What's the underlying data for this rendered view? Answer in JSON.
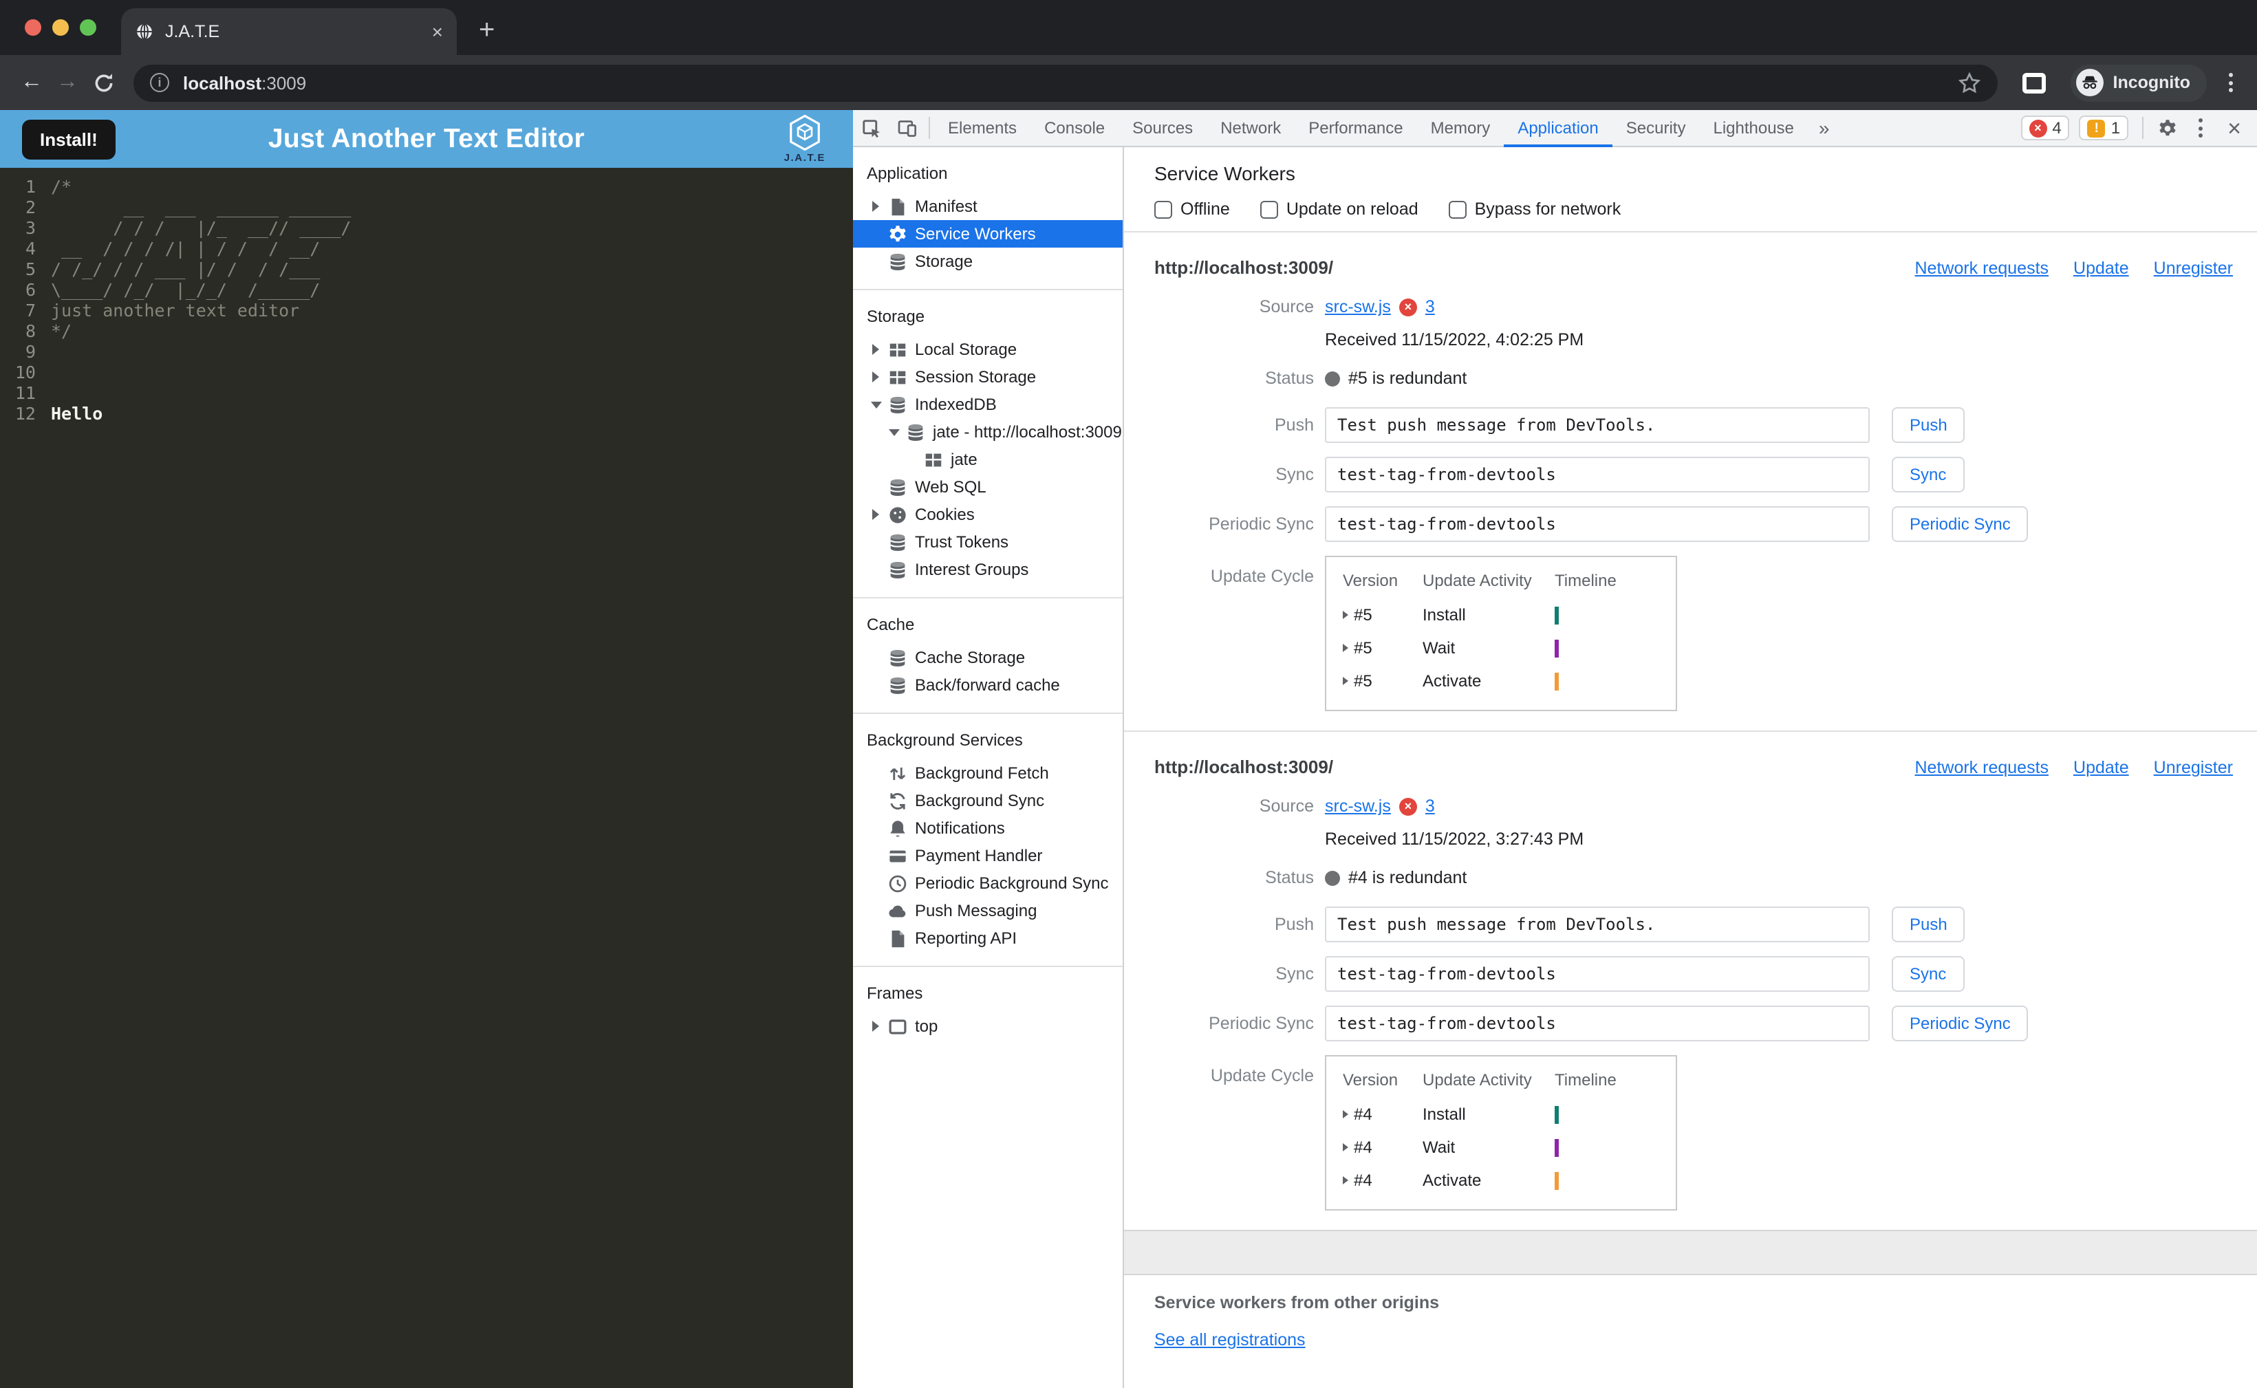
{
  "colors": {
    "accent_blue": "#1a73e8",
    "page_header_blue": "#57a7db",
    "install_install_timeline": "#0f7e71",
    "wait_timeline": "#8e24aa",
    "activate_timeline": "#f29b38"
  },
  "browser": {
    "tab_title": "J.A.T.E",
    "url_host": "localhost",
    "url_port": ":3009",
    "incognito_label": "Incognito"
  },
  "page": {
    "install_button": "Install!",
    "title": "Just Another Text Editor",
    "logo_text": "J.A.T.E",
    "editor": {
      "lines": [
        {
          "n": "1",
          "t": "/*"
        },
        {
          "n": "2",
          "t": "       __  ___  ______ ______"
        },
        {
          "n": "3",
          "t": "      / / /   |/_  __// ____/"
        },
        {
          "n": "4",
          "t": " __  / / / /| | / /  / __/"
        },
        {
          "n": "5",
          "t": "/ /_/ / / ___ |/ /  / /___"
        },
        {
          "n": "6",
          "t": "\\____/ /_/  |_/_/  /_____/"
        },
        {
          "n": "7",
          "t": "just another text editor"
        },
        {
          "n": "8",
          "t": "*/"
        },
        {
          "n": "9",
          "t": ""
        },
        {
          "n": "10",
          "t": ""
        },
        {
          "n": "11",
          "t": ""
        },
        {
          "n": "12",
          "t": "Hello"
        }
      ]
    }
  },
  "devtools": {
    "tabs": [
      {
        "label": "Elements"
      },
      {
        "label": "Console"
      },
      {
        "label": "Sources"
      },
      {
        "label": "Network"
      },
      {
        "label": "Performance"
      },
      {
        "label": "Memory"
      },
      {
        "label": "Application"
      },
      {
        "label": "Security"
      },
      {
        "label": "Lighthouse"
      }
    ],
    "more_tabs_glyph": "»",
    "badges": {
      "errors": "4",
      "warnings": "1"
    },
    "sidebar": {
      "sections": [
        {
          "title": "Application",
          "items": [
            {
              "label": "Manifest",
              "icon": "file-icon"
            },
            {
              "label": "Service Workers",
              "icon": "gear-icon"
            },
            {
              "label": "Storage",
              "icon": "database-icon"
            }
          ]
        },
        {
          "title": "Storage",
          "items": [
            {
              "label": "Local Storage",
              "icon": "table-icon"
            },
            {
              "label": "Session Storage",
              "icon": "table-icon"
            },
            {
              "label": "IndexedDB",
              "icon": "database-icon"
            },
            {
              "label": "jate - http://localhost:3009",
              "icon": "database-icon"
            },
            {
              "label": "jate",
              "icon": "table-icon"
            },
            {
              "label": "Web SQL",
              "icon": "database-icon"
            },
            {
              "label": "Cookies",
              "icon": "cookie-icon"
            },
            {
              "label": "Trust Tokens",
              "icon": "database-icon"
            },
            {
              "label": "Interest Groups",
              "icon": "database-icon"
            }
          ]
        },
        {
          "title": "Cache",
          "items": [
            {
              "label": "Cache Storage",
              "icon": "database-icon"
            },
            {
              "label": "Back/forward cache",
              "icon": "database-icon"
            }
          ]
        },
        {
          "title": "Background Services",
          "items": [
            {
              "label": "Background Fetch",
              "icon": "fetch-icon"
            },
            {
              "label": "Background Sync",
              "icon": "sync-icon"
            },
            {
              "label": "Notifications",
              "icon": "bell-icon"
            },
            {
              "label": "Payment Handler",
              "icon": "payment-icon"
            },
            {
              "label": "Periodic Background Sync",
              "icon": "clock-icon"
            },
            {
              "label": "Push Messaging",
              "icon": "cloud-icon"
            },
            {
              "label": "Reporting API",
              "icon": "file-icon"
            }
          ]
        },
        {
          "title": "Frames",
          "items": [
            {
              "label": "top",
              "icon": "frame-icon"
            }
          ]
        }
      ]
    },
    "panel": {
      "title": "Service Workers",
      "checkboxes": [
        {
          "label": "Offline"
        },
        {
          "label": "Update on reload"
        },
        {
          "label": "Bypass for network"
        }
      ],
      "workers": [
        {
          "origin": "http://localhost:3009/",
          "links": [
            {
              "label": "Network requests"
            },
            {
              "label": "Update"
            },
            {
              "label": "Unregister"
            }
          ],
          "source_label": "Source",
          "source_file": "src-sw.js",
          "source_error_count": "3",
          "received": "Received 11/15/2022, 4:02:25 PM",
          "status_label": "Status",
          "status_text": "#5 is redundant",
          "push_label": "Push",
          "push_value": "Test push message from DevTools.",
          "push_button": "Push",
          "sync_label": "Sync",
          "sync_value": "test-tag-from-devtools",
          "sync_button": "Sync",
          "periodic_label": "Periodic Sync",
          "periodic_value": "test-tag-from-devtools",
          "periodic_button": "Periodic Sync",
          "cycle_label": "Update Cycle",
          "cycle": {
            "headers": [
              {
                "label": "Version"
              },
              {
                "label": "Update Activity"
              },
              {
                "label": "Timeline"
              }
            ],
            "rows": [
              {
                "version": "#5",
                "activity": "Install",
                "tick_style": "background:#0f7e71"
              },
              {
                "version": "#5",
                "activity": "Wait",
                "tick_style": "background:#8e24aa"
              },
              {
                "version": "#5",
                "activity": "Activate",
                "tick_style": "background:#f29b38"
              }
            ]
          }
        },
        {
          "origin": "http://localhost:3009/",
          "links": [
            {
              "label": "Network requests"
            },
            {
              "label": "Update"
            },
            {
              "label": "Unregister"
            }
          ],
          "source_label": "Source",
          "source_file": "src-sw.js",
          "source_error_count": "3",
          "received": "Received 11/15/2022, 3:27:43 PM",
          "status_label": "Status",
          "status_text": "#4 is redundant",
          "push_label": "Push",
          "push_value": "Test push message from DevTools.",
          "push_button": "Push",
          "sync_label": "Sync",
          "sync_value": "test-tag-from-devtools",
          "sync_button": "Sync",
          "periodic_label": "Periodic Sync",
          "periodic_value": "test-tag-from-devtools",
          "periodic_button": "Periodic Sync",
          "cycle_label": "Update Cycle",
          "cycle": {
            "headers": [
              {
                "label": "Version"
              },
              {
                "label": "Update Activity"
              },
              {
                "label": "Timeline"
              }
            ],
            "rows": [
              {
                "version": "#4",
                "activity": "Install",
                "tick_style": "background:#0f7e71"
              },
              {
                "version": "#4",
                "activity": "Wait",
                "tick_style": "background:#8e24aa"
              },
              {
                "version": "#4",
                "activity": "Activate",
                "tick_style": "background:#f29b38"
              }
            ]
          }
        }
      ],
      "other_origins_title": "Service workers from other origins",
      "see_all_link": "See all registrations"
    }
  }
}
